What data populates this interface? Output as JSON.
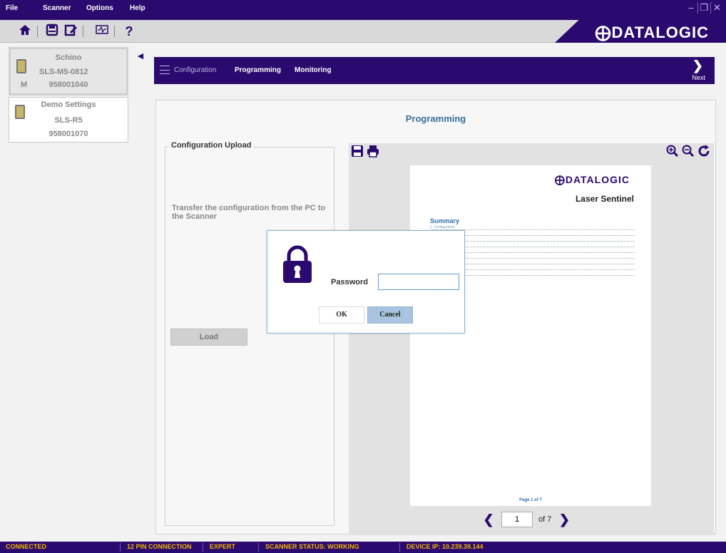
{
  "menu": [
    "File",
    "Scanner",
    "Options",
    "Help"
  ],
  "window_controls": [
    "minimize-icon",
    "restore-icon",
    "close-icon"
  ],
  "toolbar": {
    "icons": [
      "home-icon",
      "save-icon",
      "edit-document-icon",
      "monitor-icon",
      "help-icon"
    ],
    "help_glyph": "?"
  },
  "brand": "DATALOGIC",
  "devices": [
    {
      "name": "Schino",
      "model": "SLS-M5-0812",
      "serial": "958001040",
      "mark": "M",
      "selected": true
    },
    {
      "name": "Demo Settings",
      "model": "SLS-R5",
      "serial": "958001070",
      "mark": "",
      "selected": false
    }
  ],
  "nav": {
    "items": [
      "Configuration",
      "Programming",
      "Monitoring"
    ],
    "active": "Programming",
    "next_label": "Next"
  },
  "main": {
    "title": "Programming",
    "upload": {
      "legend": "Configuration Upload",
      "description": "Transfer the configuration from the PC to the Scanner",
      "load_label": "Load"
    },
    "preview": {
      "toolbar_left": [
        "save-pdf-icon",
        "print-icon"
      ],
      "toolbar_right": [
        "zoom-in-icon",
        "zoom-out-icon",
        "refresh-icon"
      ],
      "page_brand": "DATALOGIC",
      "page_product": "Laser Sentinel",
      "summary_heading": "Summary",
      "summary_first": "1. Configuration",
      "page_footer": "Page 1 of 7",
      "page_current": "1",
      "page_total_label": "of 7"
    }
  },
  "dialog": {
    "password_label": "Password",
    "password_value": "",
    "ok_label": "OK",
    "cancel_label": "Cancel"
  },
  "status": {
    "connection": "CONNECTED",
    "pins": "12 PIN CONNECTION",
    "mode": "EXPERT",
    "scanner_status": "SCANNER STATUS: WORKING",
    "device_ip": "DEVICE IP: 10.239.39.144",
    "color": "#f2b400"
  },
  "colors": {
    "brand": "#2a0a6e",
    "accent": "#3a6f99"
  }
}
